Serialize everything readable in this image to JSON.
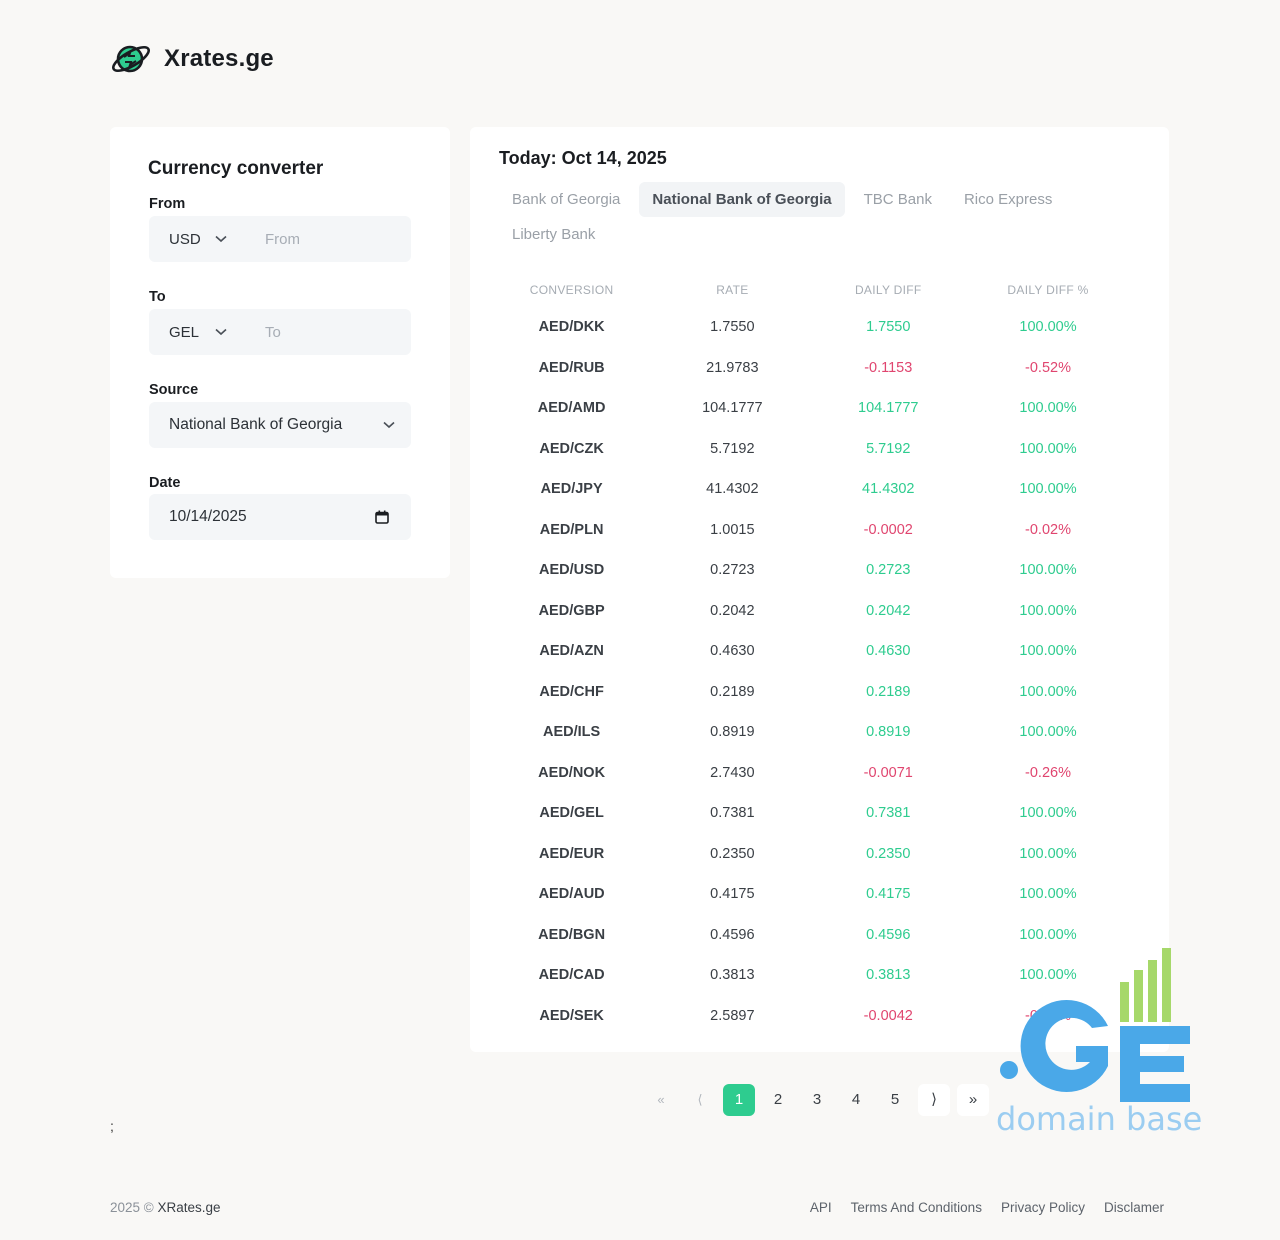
{
  "header": {
    "brand": "Xrates.ge",
    "logo_icon": "planet-exchange-icon"
  },
  "converter": {
    "title": "Currency converter",
    "from_label": "From",
    "from_currency": "USD",
    "from_placeholder": "From",
    "to_label": "To",
    "to_currency": "GEL",
    "to_placeholder": "To",
    "source_label": "Source",
    "source_value": "National Bank of Georgia",
    "date_label": "Date",
    "date_value": "10/14/2025"
  },
  "rates": {
    "today": "Today: Oct 14, 2025",
    "tabs": [
      {
        "label": "Bank of Georgia",
        "active": false
      },
      {
        "label": "National Bank of Georgia",
        "active": true
      },
      {
        "label": "TBC Bank",
        "active": false
      },
      {
        "label": "Rico Express",
        "active": false
      },
      {
        "label": "Liberty Bank",
        "active": false
      }
    ],
    "columns": [
      "CONVERSION",
      "RATE",
      "DAILY DIFF",
      "DAILY DIFF %"
    ],
    "rows": [
      {
        "pair": "AED/DKK",
        "rate": "1.7550",
        "diff": "1.7550",
        "pct": "100.00%",
        "dir": "pos"
      },
      {
        "pair": "AED/RUB",
        "rate": "21.9783",
        "diff": "-0.1153",
        "pct": "-0.52%",
        "dir": "neg"
      },
      {
        "pair": "AED/AMD",
        "rate": "104.1777",
        "diff": "104.1777",
        "pct": "100.00%",
        "dir": "pos"
      },
      {
        "pair": "AED/CZK",
        "rate": "5.7192",
        "diff": "5.7192",
        "pct": "100.00%",
        "dir": "pos"
      },
      {
        "pair": "AED/JPY",
        "rate": "41.4302",
        "diff": "41.4302",
        "pct": "100.00%",
        "dir": "pos"
      },
      {
        "pair": "AED/PLN",
        "rate": "1.0015",
        "diff": "-0.0002",
        "pct": "-0.02%",
        "dir": "neg"
      },
      {
        "pair": "AED/USD",
        "rate": "0.2723",
        "diff": "0.2723",
        "pct": "100.00%",
        "dir": "pos"
      },
      {
        "pair": "AED/GBP",
        "rate": "0.2042",
        "diff": "0.2042",
        "pct": "100.00%",
        "dir": "pos"
      },
      {
        "pair": "AED/AZN",
        "rate": "0.4630",
        "diff": "0.4630",
        "pct": "100.00%",
        "dir": "pos"
      },
      {
        "pair": "AED/CHF",
        "rate": "0.2189",
        "diff": "0.2189",
        "pct": "100.00%",
        "dir": "pos"
      },
      {
        "pair": "AED/ILS",
        "rate": "0.8919",
        "diff": "0.8919",
        "pct": "100.00%",
        "dir": "pos"
      },
      {
        "pair": "AED/NOK",
        "rate": "2.7430",
        "diff": "-0.0071",
        "pct": "-0.26%",
        "dir": "neg"
      },
      {
        "pair": "AED/GEL",
        "rate": "0.7381",
        "diff": "0.7381",
        "pct": "100.00%",
        "dir": "pos"
      },
      {
        "pair": "AED/EUR",
        "rate": "0.2350",
        "diff": "0.2350",
        "pct": "100.00%",
        "dir": "pos"
      },
      {
        "pair": "AED/AUD",
        "rate": "0.4175",
        "diff": "0.4175",
        "pct": "100.00%",
        "dir": "pos"
      },
      {
        "pair": "AED/BGN",
        "rate": "0.4596",
        "diff": "0.4596",
        "pct": "100.00%",
        "dir": "pos"
      },
      {
        "pair": "AED/CAD",
        "rate": "0.3813",
        "diff": "0.3813",
        "pct": "100.00%",
        "dir": "pos"
      },
      {
        "pair": "AED/SEK",
        "rate": "2.5897",
        "diff": "-0.0042",
        "pct": "-0.16%",
        "dir": "neg"
      }
    ]
  },
  "pagination": {
    "first": "«",
    "prev": "⟨",
    "pages": [
      "1",
      "2",
      "3",
      "4",
      "5"
    ],
    "current": "1",
    "next": "⟩",
    "last": "»"
  },
  "stray_text": ";",
  "watermark": {
    "logo_text": ".GE",
    "caption": "domain base"
  },
  "footer": {
    "copyright": "2025 ©",
    "site": "XRates.ge",
    "links": [
      "API",
      "Terms And Conditions",
      "Privacy Policy",
      "Disclamer"
    ]
  },
  "colors": {
    "positive": "#2ecc8f",
    "negative": "#e0456f",
    "accent": "#2ecc8f",
    "watermark": "#4aa8e8"
  }
}
